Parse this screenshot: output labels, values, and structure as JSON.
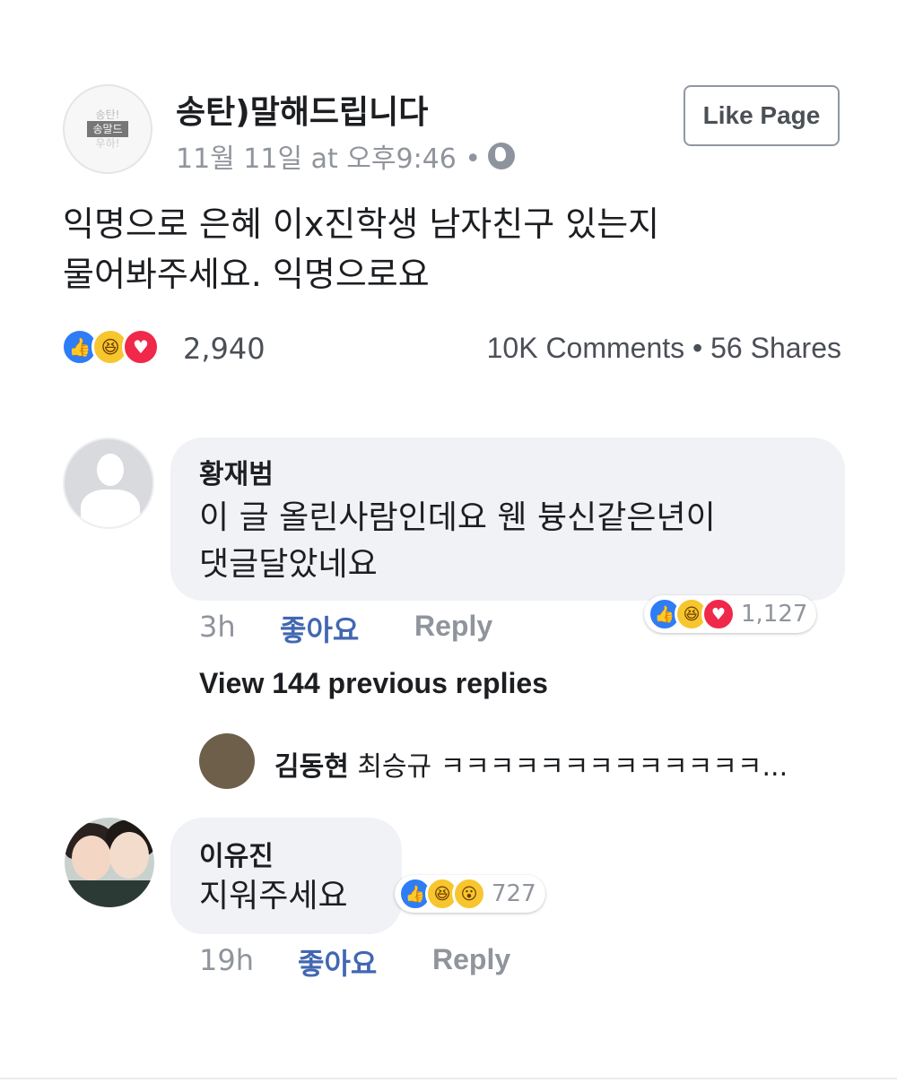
{
  "post": {
    "page_name": "송탄)말해드립니다",
    "logo_text": {
      "top": "송탄!",
      "mid": "송말드",
      "bottom": "우하!"
    },
    "timestamp": "11월 11일 at 오후9:46 •",
    "privacy_icon": "globe-icon",
    "like_page_label": "Like Page",
    "text_line1": "익명으로 은혜 이x진학생 남자친구 있는지",
    "text_line2": "물어봐주세요. 익명으로요",
    "reactions": [
      "like",
      "haha",
      "love"
    ],
    "reaction_count": "2,940",
    "comments_count": "10K Comments",
    "stats_separator": "•",
    "shares_count": "56 Shares"
  },
  "comments": [
    {
      "author": "황재범",
      "text_line1": "이 글 올린사람인데요 웬 븅신같은년이",
      "text_line2": "댓글달았네요",
      "time": "3h",
      "like_label": "좋아요",
      "reply_label": "Reply",
      "reactions": [
        "like",
        "haha",
        "love"
      ],
      "reaction_count": "1,127"
    },
    {
      "author": "이유진",
      "text": "지워주세요",
      "time": "19h",
      "like_label": "좋아요",
      "reply_label": "Reply",
      "reactions": [
        "like",
        "haha",
        "wow"
      ],
      "reaction_count": "727"
    }
  ],
  "view_previous_replies": "View 144 previous replies",
  "latest_reply": {
    "author": "김동현",
    "text": "최승규 ㅋㅋㅋㅋㅋㅋㅋㅋㅋㅋㅋㅋㅋ..."
  },
  "icons": {
    "like": "👍",
    "haha": "😆",
    "love": "♥",
    "wow": "😮"
  },
  "colors": {
    "link_blue": "#4267b2",
    "like_blue": "#2e7cf6",
    "love_red": "#f0284a",
    "haha_yellow": "#f7c62e",
    "muted_gray": "#90949c"
  }
}
